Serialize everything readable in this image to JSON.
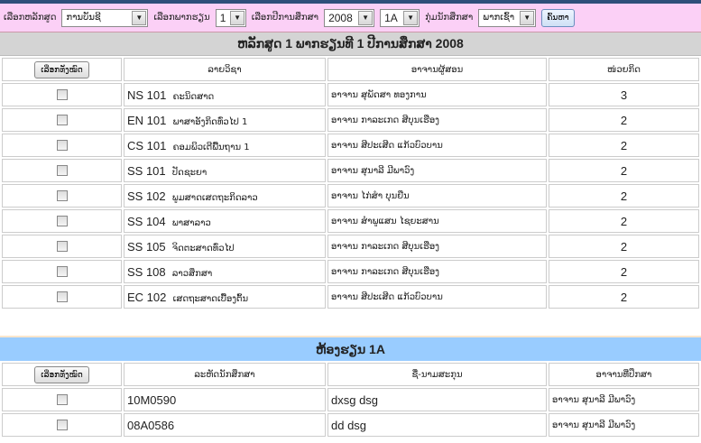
{
  "filter": {
    "curriculum_label": "ເລືອກຫລັກສູດ",
    "curriculum_value": "ການບັນຊີ",
    "semester_label": "ເລືອກພາກຮຽນ",
    "semester_value": "1",
    "year_label": "ເລືອກປີການສຶກສາ",
    "year_value": "2008",
    "class_value": "1A",
    "group_label": "ກຸ່ມນັກສຶກສາ",
    "group_value": "ພາກເຊົ້າ",
    "search_label": "ຄົ້ນຫາ"
  },
  "courses": {
    "title": "ຫລັກສູດ 1 ພາກຮຽນທີ 1 ປີການສຶກສາ 2008",
    "select_all": "ເລືອກທັງໝົດ",
    "headers": [
      "ລາຍວິຊາ",
      "ອາຈານຜູ້ສອນ",
      "ໜ່ວຍກິດ"
    ],
    "rows": [
      {
        "code": "NS 101",
        "name": "ຄະນິດສາດ",
        "teacher": "ອາຈານ ສຸພັດສາ ທອງການ",
        "credits": "3"
      },
      {
        "code": "EN 101",
        "name": "ພາສາອັງກິດທົ່ວໄປ 1",
        "teacher": "ອາຈານ ກາລະເກດ ສີບຸນເຮືອງ",
        "credits": "2"
      },
      {
        "code": "CS 101",
        "name": "ຄອມພິວເຕີພື້ນຖານ 1",
        "teacher": "ອາຈານ ສີປະເສີດ ແກ້ວບົວບານ",
        "credits": "2"
      },
      {
        "code": "SS 101",
        "name": "ປັດຊະຍາ",
        "teacher": "ອາຈານ ສຸນາລີ ມີພາວົງ",
        "credits": "2"
      },
      {
        "code": "SS 102",
        "name": "ພູມສາດເສດຖະກິດລາວ",
        "teacher": "ອາຈານ ໄກ່ສໍາ ບຸນຍືນ",
        "credits": "2"
      },
      {
        "code": "SS 104",
        "name": "ພາສາລາວ",
        "teacher": "ອາຈານ ສໍາພູແສນ ໄຊຍະສານ",
        "credits": "2"
      },
      {
        "code": "SS 105",
        "name": "ຈິດຕະສາດທົ່ວໄປ",
        "teacher": "ອາຈານ ກາລະເກດ ສີບຸນເຮືອງ",
        "credits": "2"
      },
      {
        "code": "SS 108",
        "name": "ລາວສຶກສາ",
        "teacher": "ອາຈານ ກາລະເກດ ສີບຸນເຮືອງ",
        "credits": "2"
      },
      {
        "code": "EC 102",
        "name": "ເສດຖະສາດເບື້ອງຕົ້ນ",
        "teacher": "ອາຈານ ສີປະເສີດ ແກ້ວບົວບານ",
        "credits": "2"
      }
    ]
  },
  "students": {
    "title": "ຫ້ອງຮຽນ 1A",
    "select_all": "ເລືອກທັງໝົດ",
    "headers": [
      "ລະຫັດນັກສຶກສາ",
      "ຊື່-ນາມສະກຸນ",
      "ອາຈານທີ່ປຶກສາ"
    ],
    "rows": [
      {
        "id": "10M0590",
        "name": "dxsg dsg",
        "advisor": "ອາຈານ ສຸນາລີ ມີພາວົງ"
      },
      {
        "id": "08A0586",
        "name": "dd dsg",
        "advisor": "ອາຈານ ສຸນາລີ ມີພາວົງ"
      }
    ]
  }
}
